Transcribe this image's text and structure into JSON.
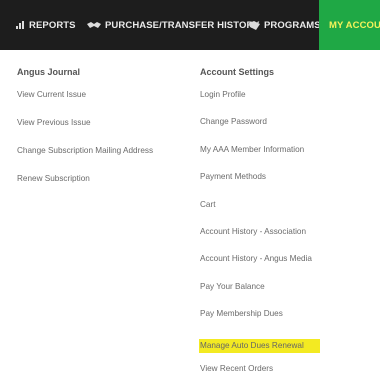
{
  "nav": {
    "items": [
      {
        "label": "REPORTS",
        "icon": "bar-chart-icon"
      },
      {
        "label": "PURCHASE/TRANSFER HISTORY",
        "icon": "handshake-icon"
      },
      {
        "label": "PROGRAMS",
        "icon": "tag-icon"
      },
      {
        "label": "MY ACCOUNT",
        "icon": ""
      }
    ],
    "active_color": "#1fa845"
  },
  "journal": {
    "heading": "Angus Journal",
    "links": [
      "View Current Issue",
      "View Previous Issue",
      "Change Subscription Mailing Address",
      "Renew Subscription"
    ]
  },
  "account": {
    "heading": "Account Settings",
    "links": [
      "Login Profile",
      "Change Password",
      "My AAA Member Information",
      "Payment Methods",
      "Cart",
      "Account History - Association",
      "Account History - Angus Media",
      "Pay Your Balance",
      "Pay Membership Dues",
      "Manage Auto Dues Renewal",
      "View Recent Orders"
    ],
    "highlighted": "Manage Auto Dues Renewal",
    "highlight_color": "#f3ea22"
  }
}
